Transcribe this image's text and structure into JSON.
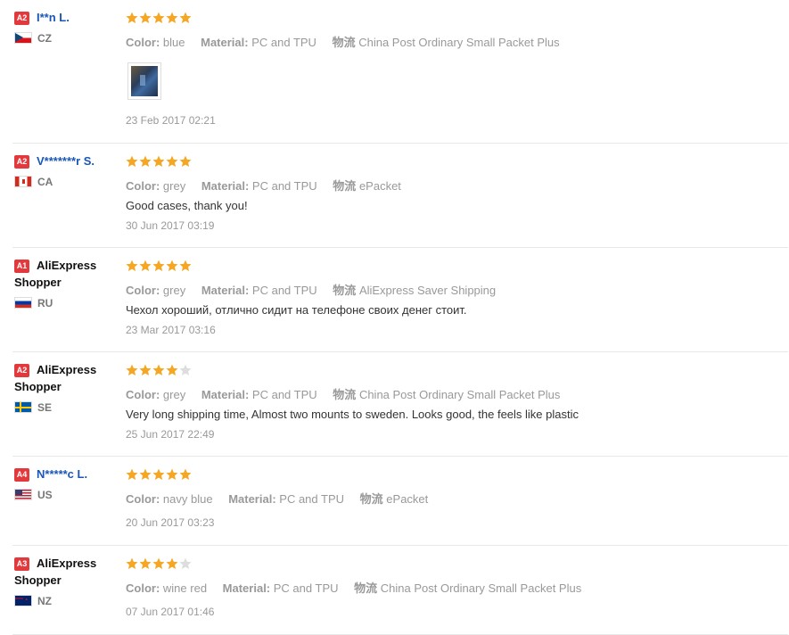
{
  "labels": {
    "color": "Color:",
    "material": "Material:",
    "shipping": "物流"
  },
  "star_color_on": "#f5a623",
  "star_color_off": "#dddddd",
  "reviews": [
    {
      "badge": "A2",
      "name": "I**n L.",
      "country": "CZ",
      "flag": "flag-cz",
      "rating": 5,
      "color": "blue",
      "material": "PC and TPU",
      "shipping": "China Post Ordinary Small Packet Plus",
      "text": "",
      "date": "23 Feb 2017 02:21",
      "has_photo": true
    },
    {
      "badge": "A2",
      "name": "V*******r S.",
      "country": "CA",
      "flag": "flag-ca",
      "rating": 5,
      "color": "grey",
      "material": "PC and TPU",
      "shipping": "ePacket",
      "text": "Good cases, thank you!",
      "date": "30 Jun 2017 03:19"
    },
    {
      "badge": "A1",
      "name": "AliExpress",
      "name2": "Shopper",
      "country": "RU",
      "flag": "flag-ru",
      "rating": 5,
      "color": "grey",
      "material": "PC and TPU",
      "shipping": "AliExpress Saver Shipping",
      "text": "Чехол хороший, отлично сидит на телефоне своих денег стоит.",
      "date": "23 Mar 2017 03:16"
    },
    {
      "badge": "A2",
      "name": "AliExpress",
      "name2": "Shopper",
      "country": "SE",
      "flag": "flag-se",
      "rating": 4,
      "color": "grey",
      "material": "PC and TPU",
      "shipping": "China Post Ordinary Small Packet Plus",
      "text": "Very long shipping time, Almost two mounts to sweden. Looks good, the feels like plastic",
      "date": "25 Jun 2017 22:49"
    },
    {
      "badge": "A4",
      "name": "N*****c L.",
      "country": "US",
      "flag": "flag-us",
      "rating": 5,
      "color": "navy blue",
      "material": "PC and TPU",
      "shipping": "ePacket",
      "text": "",
      "date": "20 Jun 2017 03:23"
    },
    {
      "badge": "A3",
      "name": "AliExpress",
      "name2": "Shopper",
      "country": "NZ",
      "flag": "flag-nz",
      "rating": 4,
      "color": "wine red",
      "material": "PC and TPU",
      "shipping": "China Post Ordinary Small Packet Plus",
      "text": "",
      "date": "07 Jun 2017 01:46"
    }
  ]
}
